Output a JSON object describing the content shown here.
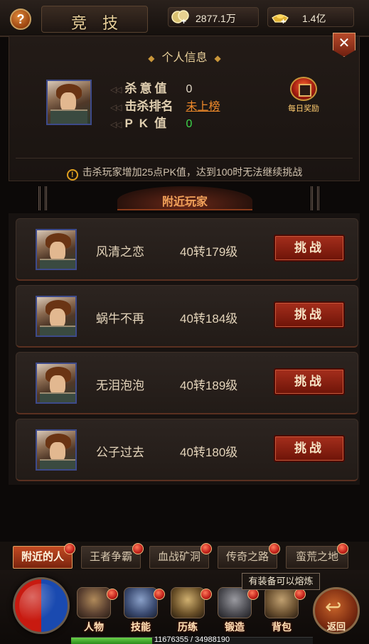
{
  "header": {
    "title": "竞技",
    "help_label": "?",
    "currency1": {
      "icon": "coin-icon",
      "value": "2877.1万"
    },
    "currency2": {
      "icon": "gold-ingot-icon",
      "value": "1.4亿"
    }
  },
  "info": {
    "section_title": "个人信息",
    "close_label": "✕",
    "stats": [
      {
        "label": "杀意值",
        "value": "0",
        "style": "plain"
      },
      {
        "label": "击杀排名",
        "value": "未上榜",
        "style": "link"
      },
      {
        "label": "PK值",
        "value": "0",
        "style": "green"
      }
    ],
    "daily_reward_label": "每日奖励",
    "warning": "击杀玩家增加25点PK值，达到100时无法继续挑战"
  },
  "nearby": {
    "title": "附近玩家",
    "challenge_label": "挑战",
    "players": [
      {
        "name": "风清之恋",
        "level": "40转179级"
      },
      {
        "name": "蜗牛不再",
        "level": "40转184级"
      },
      {
        "name": "无泪泡泡",
        "level": "40转189级"
      },
      {
        "name": "公子过去",
        "level": "40转180级"
      }
    ]
  },
  "tabs": [
    {
      "label": "附近的人",
      "active": true
    },
    {
      "label": "王者争霸",
      "active": false
    },
    {
      "label": "血战矿洞",
      "active": false
    },
    {
      "label": "传奇之路",
      "active": false
    },
    {
      "label": "蛮荒之地",
      "active": false
    }
  ],
  "bottom_menu": [
    {
      "label": "人物",
      "icon": "helmet-icon"
    },
    {
      "label": "技能",
      "icon": "skill-book-icon"
    },
    {
      "label": "历练",
      "icon": "armor-icon"
    },
    {
      "label": "锻造",
      "icon": "anvil-icon"
    },
    {
      "label": "背包",
      "icon": "bag-icon"
    }
  ],
  "back_label": "返回",
  "tooltip": "有装备可以熔炼",
  "xp": {
    "text": "11676355 / 34988190",
    "fraction": 0.334
  },
  "colors": {
    "accent": "#c24a22",
    "challenge_button": "#a52e1c",
    "link": "#f08a2a",
    "pk_value": "#3dd64a"
  }
}
